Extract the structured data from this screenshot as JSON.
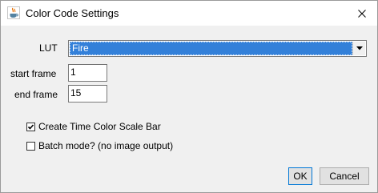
{
  "window": {
    "title": "Color Code Settings",
    "app_icon": "java-cup-icon",
    "close_icon": "close-icon"
  },
  "form": {
    "lut_label": "LUT",
    "lut_value": "Fire",
    "start_frame_label": "start frame",
    "start_frame_value": "1",
    "end_frame_label": "end frame",
    "end_frame_value": "15",
    "create_scale_bar_label": "Create Time Color Scale Bar",
    "create_scale_bar_checked": true,
    "batch_mode_label": "Batch mode? (no image output)",
    "batch_mode_checked": false
  },
  "buttons": {
    "ok_label": "OK",
    "cancel_label": "Cancel"
  }
}
